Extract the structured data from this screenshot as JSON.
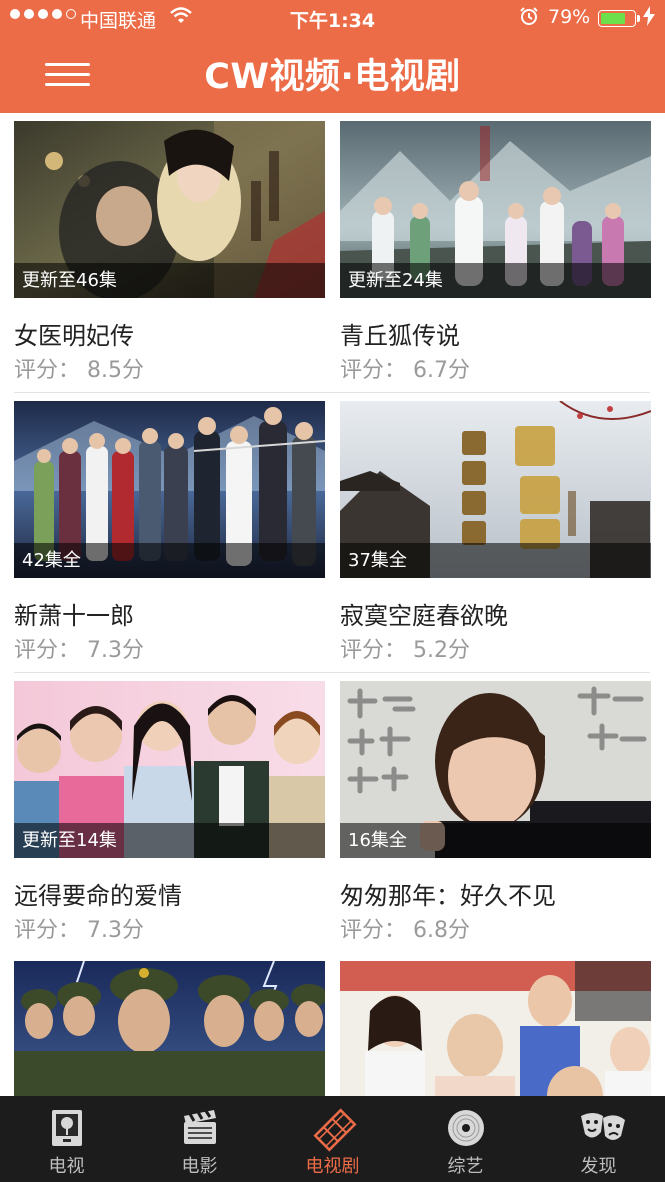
{
  "status_bar": {
    "carrier": "中国联通",
    "time": "下午1:34",
    "battery_percent": "79%",
    "battery_level": 0.79
  },
  "nav": {
    "title": "CW视频·电视剧"
  },
  "shows": [
    {
      "title": "女医明妃传",
      "rating": "评分：  8.5分",
      "badge": "更新至46集"
    },
    {
      "title": "青丘狐传说",
      "rating": "评分：  6.7分",
      "badge": "更新至24集"
    },
    {
      "title": "新萧十一郎",
      "rating": "评分：  7.3分",
      "badge": "42集全"
    },
    {
      "title": "寂寞空庭春欲晚",
      "rating": "评分：  5.2分",
      "badge": "37集全"
    },
    {
      "title": "远得要命的爱情",
      "rating": "评分：  7.3分",
      "badge": "更新至14集"
    },
    {
      "title": "匆匆那年：好久不见",
      "rating": "评分：  6.8分",
      "badge": "16集全"
    },
    {
      "title": "",
      "rating": "",
      "badge": ""
    },
    {
      "title": "",
      "rating": "",
      "badge": ""
    }
  ],
  "tabs": [
    {
      "label": "电视",
      "icon": "tv-icon"
    },
    {
      "label": "电影",
      "icon": "clapperboard-icon"
    },
    {
      "label": "电视剧",
      "icon": "film-strip-icon",
      "active": true
    },
    {
      "label": "综艺",
      "icon": "disc-icon"
    },
    {
      "label": "发现",
      "icon": "theater-masks-icon"
    }
  ],
  "colors": {
    "accent": "#ec6c48",
    "tabbar_bg": "#1c1c1c",
    "tab_inactive": "#bdbdbd"
  }
}
